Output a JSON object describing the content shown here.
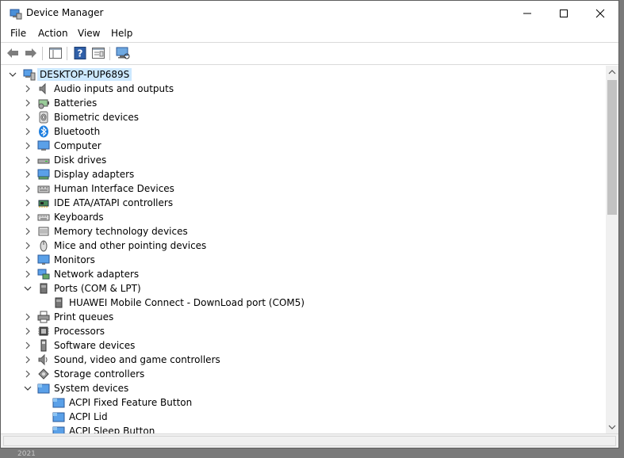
{
  "window": {
    "title": "Device Manager"
  },
  "menu": {
    "file": "File",
    "action": "Action",
    "view": "View",
    "help": "Help"
  },
  "tree": {
    "root": "DESKTOP-PUP689S",
    "categories": [
      {
        "label": "Audio inputs and outputs",
        "icon": "speaker-icon"
      },
      {
        "label": "Batteries",
        "icon": "battery-icon"
      },
      {
        "label": "Biometric devices",
        "icon": "fingerprint-icon"
      },
      {
        "label": "Bluetooth",
        "icon": "bluetooth-icon"
      },
      {
        "label": "Computer",
        "icon": "computer-icon"
      },
      {
        "label": "Disk drives",
        "icon": "disk-icon"
      },
      {
        "label": "Display adapters",
        "icon": "display-adapter-icon"
      },
      {
        "label": "Human Interface Devices",
        "icon": "hid-icon"
      },
      {
        "label": "IDE ATA/ATAPI controllers",
        "icon": "ide-controller-icon"
      },
      {
        "label": "Keyboards",
        "icon": "keyboard-icon"
      },
      {
        "label": "Memory technology devices",
        "icon": "memory-icon"
      },
      {
        "label": "Mice and other pointing devices",
        "icon": "mouse-icon"
      },
      {
        "label": "Monitors",
        "icon": "monitor-icon"
      },
      {
        "label": "Network adapters",
        "icon": "network-icon"
      },
      {
        "label": "Ports (COM & LPT)",
        "icon": "port-icon"
      },
      {
        "label": "HUAWEI Mobile Connect - DownLoad port (COM5)",
        "icon": "port-icon"
      },
      {
        "label": "Print queues",
        "icon": "printer-icon"
      },
      {
        "label": "Processors",
        "icon": "processor-icon"
      },
      {
        "label": "Software devices",
        "icon": "software-device-icon"
      },
      {
        "label": "Sound, video and game controllers",
        "icon": "sound-icon"
      },
      {
        "label": "Storage controllers",
        "icon": "storage-icon"
      },
      {
        "label": "System devices",
        "icon": "system-device-icon"
      },
      {
        "label": "ACPI Fixed Feature Button",
        "icon": "system-device-icon"
      },
      {
        "label": "ACPI Lid",
        "icon": "system-device-icon"
      },
      {
        "label": "ACPI Sleep Button",
        "icon": "system-device-icon"
      }
    ]
  },
  "below_text": "2021",
  "colors": {
    "selection": "#cce8ff",
    "scrollbar_thumb": "#c2c2c2",
    "accent": "#1e90ff"
  }
}
